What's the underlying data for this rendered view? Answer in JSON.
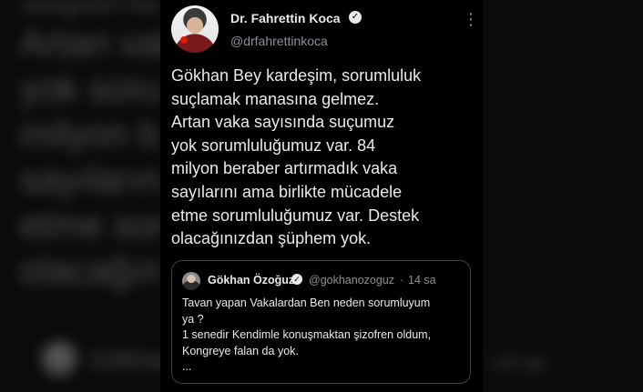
{
  "background": {
    "blurred_text": "suçlama\nArtan vaka\nyok soru\nmilyon b\nsayıların\netme sor\nolacağın",
    "blurred_quote_name": "Gökhan",
    "blurred_time": "14 sa"
  },
  "tweet": {
    "display_name": "Dr. Fahrettin Koca",
    "handle": "@drfahrettinkoca",
    "body": "Gökhan Bey kardeşim, sorumluluk\nsuçlamak manasına gelmez.\nArtan vaka sayısında suçumuz\nyok sorumluluğumuz var. 84\nmilyon beraber artırmadık vaka\nsayılarını ama birlikte mücadele\netme sorumluluğumuz var. Destek\nolacağınızdan şüphem yok.",
    "verified_icon": "✓",
    "more_icon": "⋮"
  },
  "quote": {
    "display_name": "Gökhan Özoğuz",
    "handle": "@gokhanozoguz",
    "separator": "·",
    "time": "14 sa",
    "body": "Tavan yapan Vakalardan Ben neden sorumluyum\nya ?\n1 senedir Kendimle konuşmaktan şizofren oldum,\nKongreye falan da yok.\n...",
    "verified_icon": "✓"
  },
  "colors": {
    "card_background": "#000000",
    "text_primary": "#e7e9ea",
    "text_secondary": "#8b9096",
    "border": "#3b3f43"
  }
}
